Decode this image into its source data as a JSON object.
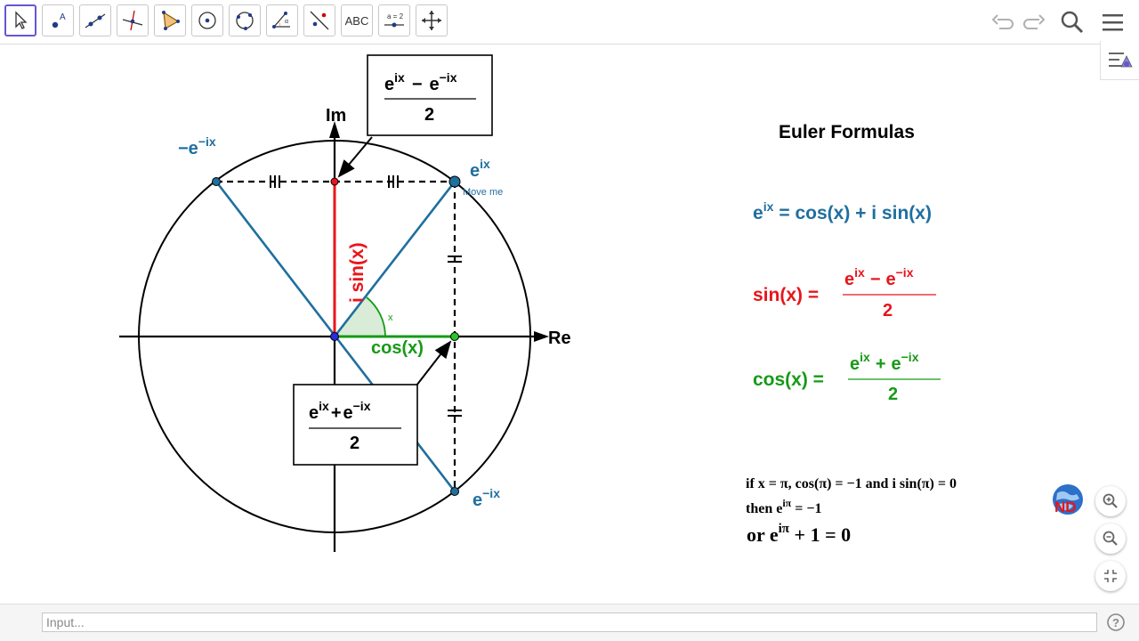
{
  "toolbar": {
    "text_tool_label": "ABC",
    "slider_tool_label": "a = 2"
  },
  "canvas": {
    "axis_im": "Im",
    "axis_re": "Re",
    "point_eix": "e",
    "point_eix_sup": "ix",
    "point_neg_eix": "−e",
    "point_neg_eix_sup": "−ix",
    "point_e_negix": "e",
    "point_e_negix_sup": "−ix",
    "move_me": "Move me",
    "angle_label": "x",
    "isin_label": "i sin(x)",
    "cos_label": "cos(x)",
    "box_top": {
      "num_a": "e",
      "num_a_sup": "ix",
      "num_op": "−",
      "num_b": "e",
      "num_b_sup": "−ix",
      "den": "2"
    },
    "box_bottom": {
      "num_a": "e",
      "num_a_sup": "ix",
      "num_op": "+",
      "num_b": "e",
      "num_b_sup": "−ix",
      "den": "2"
    },
    "title": "Euler Formulas",
    "formula1": {
      "lhs": "e",
      "lhs_sup": "ix",
      "rhs": "= cos(x) + i sin(x)"
    },
    "formula2": {
      "lhs": "sin(x) =",
      "num_a": "e",
      "num_a_sup": "ix",
      "num_op": "−",
      "num_b": "e",
      "num_b_sup": "−ix",
      "den": "2"
    },
    "formula3": {
      "lhs": "cos(x) =",
      "num_a": "e",
      "num_a_sup": "ix",
      "num_op": "+",
      "num_b": "e",
      "num_b_sup": "−ix",
      "den": "2"
    },
    "note_line1": "if x = π, cos(π) = −1 and i sin(π) = 0",
    "note_line2_a": "then e",
    "note_line2_sup": "iπ",
    "note_line2_b": " = −1",
    "note_line3_a": "or e",
    "note_line3_sup": "iπ",
    "note_line3_b": " + 1 = 0",
    "logo_text": "ND"
  },
  "input_bar": {
    "placeholder": "Input..."
  },
  "colors": {
    "blue": "#1f6f9f",
    "red": "#e8151b",
    "green": "#169a16",
    "accent": "#6557d2"
  }
}
